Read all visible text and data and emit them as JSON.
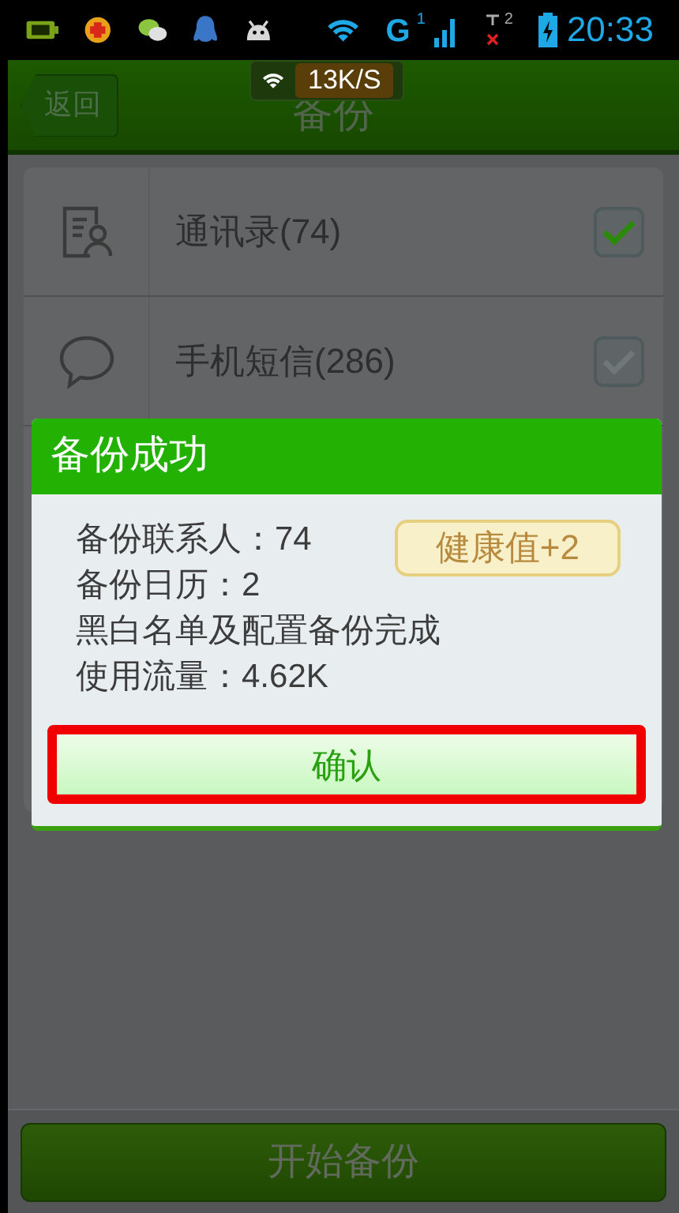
{
  "status_bar": {
    "network_type": "G",
    "sim1": "1",
    "sim2": "2",
    "time": "20:33"
  },
  "speed_toast": {
    "speed": "13K/S"
  },
  "header": {
    "back": "返回",
    "title": "备份"
  },
  "items": [
    {
      "label": "通讯录(74)",
      "kind": "contacts",
      "checked": true
    },
    {
      "label": "手机短信(286)",
      "kind": "message",
      "checked": false
    }
  ],
  "dialog": {
    "title": "备份成功",
    "lines": [
      "备份联系人：74",
      "备份日历：2",
      "黑白名单及配置备份完成",
      "使用流量：4.62K"
    ],
    "badge": "健康值+2",
    "confirm": "确认",
    "highlighted": true
  },
  "footer": {
    "button": "开始备份"
  }
}
